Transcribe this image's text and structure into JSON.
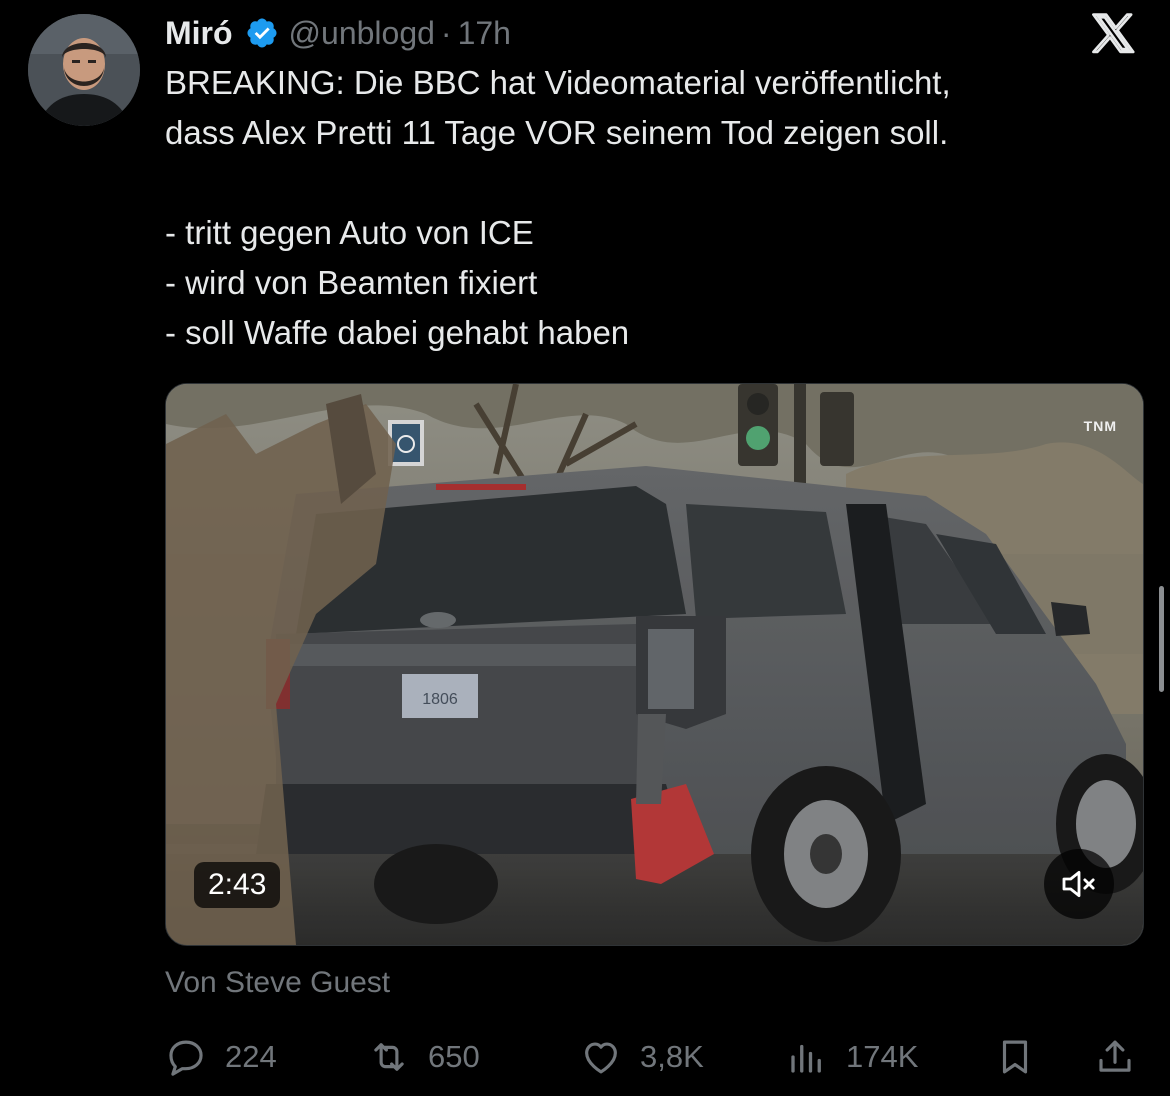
{
  "tweet": {
    "author_name": "Miró",
    "handle": "@unblogd",
    "separator": "·",
    "time": "17h",
    "lines": [
      "BREAKING: Die BBC hat Videomaterial veröffentlicht,",
      "dass Alex Pretti 11 Tage VOR seinem Tod zeigen soll."
    ],
    "bullets": [
      "- tritt gegen Auto von ICE",
      "- wird von Beamten fixiert",
      "- soll Waffe dabei gehabt haben"
    ],
    "attribution": "Von Steve Guest"
  },
  "media": {
    "watermark": "TNM",
    "plate_text": "1806",
    "duration": "2:43",
    "muted": true
  },
  "stats": {
    "replies": "224",
    "reposts": "650",
    "likes": "3,8K",
    "views": "174K"
  },
  "colors": {
    "background": "#000000",
    "text": "#e7e9ea",
    "secondary": "#71767b",
    "verified": "#1d9bf0"
  },
  "icons": {
    "verified": "verified-badge-icon",
    "close": "x-logo-icon",
    "reply": "reply-icon",
    "repost": "repost-icon",
    "like": "heart-icon",
    "views": "views-icon",
    "bookmark": "bookmark-icon",
    "share": "share-icon",
    "mute": "volume-muted-icon"
  }
}
